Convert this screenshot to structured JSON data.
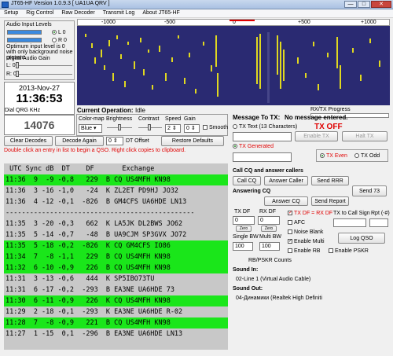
{
  "window": {
    "title": "JT65-HF Version 1.0.9.3  [ UA1UA QRV ]",
    "min": "—",
    "max": "□",
    "close": "✕"
  },
  "menu": [
    "Setup",
    "Rig Control",
    "Raw Decoder",
    "Transmit Log",
    "About JT65-HF"
  ],
  "audio": {
    "title": "Audio Input Levels",
    "l_label": "L 0",
    "r_label": "R 0",
    "note": "Optimum input level is 0 with only background noise present.",
    "gain_label": "Digital Audio Gain",
    "lgain": "L: 0",
    "rgain": "R: 0"
  },
  "clock": {
    "date": "2013-Nov-27",
    "time": "11:36:53"
  },
  "dial": {
    "label": "Dial QRG KHz",
    "value": "14076"
  },
  "waterfall": {
    "ticks": [
      "-1000",
      "-500",
      "0",
      "+500",
      "+1000"
    ]
  },
  "operation": {
    "label": "Current Operation:",
    "value": "Idle"
  },
  "rx_progress": "RX/TX Progress",
  "controls": {
    "colormap_label": "Color-map",
    "colormap_value": "Blue",
    "brightness_label": "Brightness",
    "contrast_label": "Contrast",
    "speed_label": "Speed",
    "speed_value": "2",
    "gain_label": "Gain",
    "gain_value": "0",
    "smooth_label": "Smooth"
  },
  "buttons": {
    "clear_decodes": "Clear Decodes",
    "decode_again": "Decode Again",
    "dt_offset_value": "0",
    "dt_offset_label": "DT Offset",
    "restore_defaults": "Restore Defaults",
    "enable_tx": "Enable TX",
    "halt_tx": "Halt TX",
    "call_cq": "Call CQ",
    "answer_caller": "Answer Caller",
    "send_rrr": "Send RRR",
    "send_73": "Send 73",
    "answer_cq": "Answer CQ",
    "send_report": "Send Report",
    "log_qso": "Log QSO",
    "zero_1": "Zero",
    "zero_2": "Zero"
  },
  "hint": "Double click an entry in list to begin a QSO.  Right click copies to clipboard.",
  "tx": {
    "title": "Message To TX:",
    "no_msg": "No message entered.",
    "tx_text_label": "TX Text (13 Characters)",
    "tx_off": "TX OFF",
    "tx_generated": "TX Generated",
    "tx_even": "TX Even",
    "tx_odd": "TX Odd"
  },
  "qso": {
    "call_cq_section": "Call CQ and answer callers",
    "answering_cq": "Answering CQ",
    "tx_df": "TX DF",
    "rx_df": "RX DF",
    "tx_df_value": "0",
    "rx_df_value": "0",
    "single_bw": "Single BW",
    "multi_bw": "Multi BW",
    "single_bw_value": "100",
    "multi_bw_value": "100",
    "tx_eq_rx": "TX DF = RX DF",
    "afc": "AFC",
    "noise_blank": "Noise Blank",
    "enable_multi": "Enable Multi",
    "enable_rb": "Enable RB",
    "enable_pskr": "Enable PSKR",
    "tx_to_callsign": "TX to Call Sign",
    "rpt": "Rpt (-#)",
    "rb_counts": "RB/PSKR Counts"
  },
  "sound": {
    "in_label": "Sound In:",
    "in_value": "02-Line 1 (Virtual Audio Cable)",
    "out_label": "Sound Out:",
    "out_value": "04-Динамики (Realtek High Definiti"
  },
  "decodes": {
    "header": " UTC Sync dB  DT    DF       Exchange",
    "rows": [
      {
        "text": "11:36  9  -9 -0,8   229  B CQ US4MFH KN98",
        "color": "#1ae61a"
      },
      {
        "text": "11:36  3 -16 -1,0   -24  K ZL2ET PD9HJ JO32",
        "color": "#c8c8c8"
      },
      {
        "text": "11:36  4 -12 -0,1  -826  B GM4CFS UA6HDE LN13",
        "color": "#c8c8c8"
      },
      {
        "text": "-----------------------------------------------",
        "color": "#c8c8c8"
      },
      {
        "text": "11:35  3 -20 -0,3   662  K LA5JK DL2BWS JO62",
        "color": "#c8c8c8"
      },
      {
        "text": "11:35  5 -14 -0,7   -48  B UA9CJM SP3GVX JO72",
        "color": "#c8c8c8"
      },
      {
        "text": "11:35  5 -18 -0,2  -826  K CQ GM4CFS IO86",
        "color": "#1ae61a"
      },
      {
        "text": "11:34  7  -8 -1,1   229  B CQ US4MFH KN98",
        "color": "#1ae61a"
      },
      {
        "text": "11:32  6 -10 -0,9   226  B CQ US4MFH KN98",
        "color": "#1ae61a"
      },
      {
        "text": "11:31  3 -13 -0,6   444  K SP5IBO73TU",
        "color": "#c8c8c8"
      },
      {
        "text": "11:31  6 -17 -0,2  -293  B EA3NE UA6HDE 73",
        "color": "#c8c8c8"
      },
      {
        "text": "11:30  6 -11 -0,9   226  K CQ US4MFH KN98",
        "color": "#1ae61a"
      },
      {
        "text": "11:29  2 -18 -0,1  -293  K EA3NE UA6HDE R-02",
        "color": "#c8c8c8"
      },
      {
        "text": "11:28  7  -8 -0,9   221  B CQ US4MFH KN98",
        "color": "#1ae61a"
      },
      {
        "text": "11:27  1 -15  0,1  -296  B EA3NE UA6HDE LN13",
        "color": "#c8c8c8"
      }
    ]
  },
  "colors": {
    "accent_red": "#e00000",
    "highlight_green": "#1ae61a",
    "waterfall_bg": "#2a2a72"
  }
}
